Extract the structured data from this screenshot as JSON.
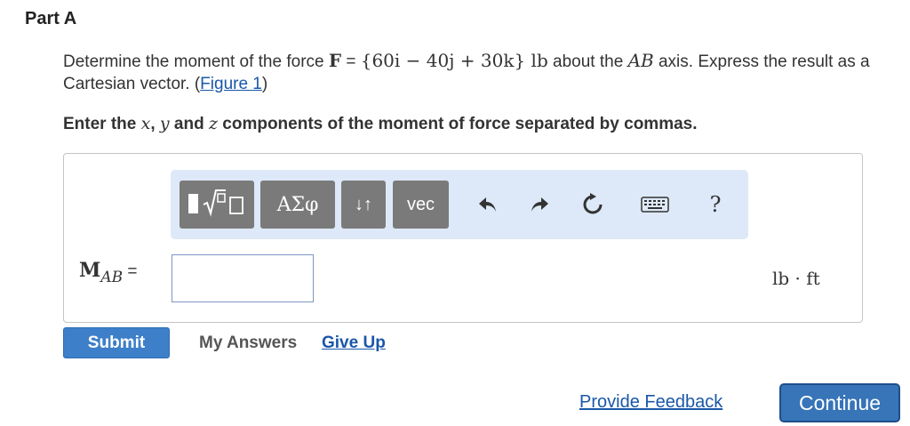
{
  "part": {
    "title": "Part A"
  },
  "question": {
    "text_before": "Determine the moment of the force ",
    "force_symbol": "F",
    "equals": " = ",
    "force_vector": "{60i  −  40j  +  30k}",
    "force_unit": " lb",
    "text_middle": " about the ",
    "axis": "AB",
    "text_after": " axis. Express the result as a Cartesian vector. (",
    "figure_link": "Figure 1",
    "close_paren": ")"
  },
  "instruction": {
    "before": "Enter the ",
    "x": "x",
    "comma1": ", ",
    "y": "y",
    "and": " and ",
    "z": "z",
    "after": " components of the moment of force separated by commas."
  },
  "toolbar": {
    "templates_icon": "templates-icon",
    "greek_label": "ΑΣφ",
    "arrows_label": "↓↑",
    "vec_label": "vec",
    "undo_icon": "undo-icon",
    "redo_icon": "redo-icon",
    "reset_icon": "reset-icon",
    "keyboard_icon": "keyboard-icon",
    "help_label": "?"
  },
  "answer": {
    "label_main": "M",
    "label_sub": "AB",
    "label_equals": " =",
    "value": "",
    "units": "lb · ft"
  },
  "actions": {
    "submit": "Submit",
    "my_answers": "My Answers",
    "give_up": "Give Up"
  },
  "footer": {
    "feedback": "Provide Feedback",
    "continue": "Continue"
  },
  "colors": {
    "link": "#1a57a8",
    "toolbar_bg": "#dde9f8",
    "button_gray": "#7a7a7a",
    "submit_blue": "#3d7fc9",
    "continue_blue": "#3774b8"
  }
}
